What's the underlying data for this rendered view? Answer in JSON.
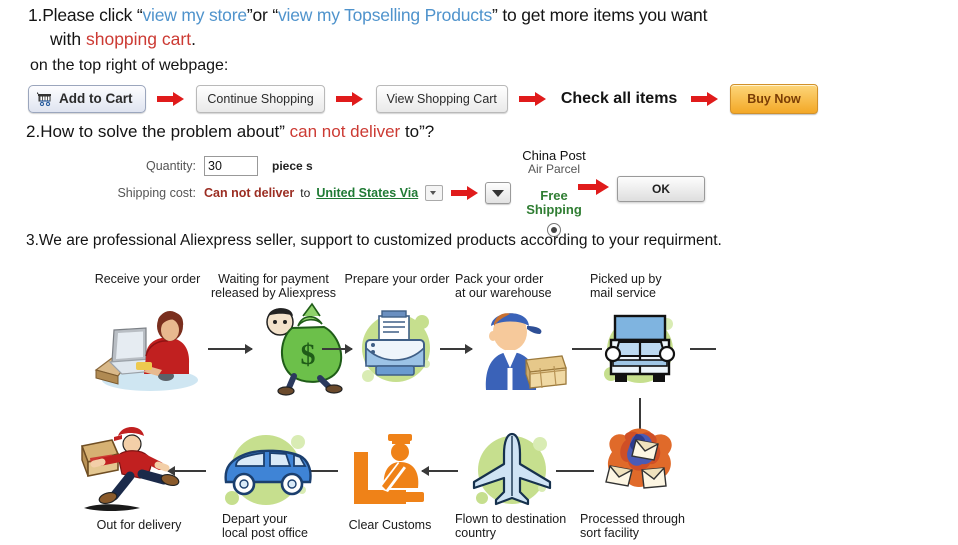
{
  "section1": {
    "number": "1.",
    "text_before_link1": "Please click “",
    "link1": "view my store",
    "text_between": "”or “",
    "link2": "view my Topselling Products",
    "text_after_link2": "” to get  more items you want",
    "line2_prefix": "with ",
    "line2_highlight": "shopping cart",
    "line2_suffix": ".",
    "line3": "on the top right of webpage:"
  },
  "buttons": {
    "add_to_cart": "Add to Cart",
    "continue_shopping": "Continue Shopping",
    "view_shopping_cart": "View Shopping Cart",
    "check_all_items": "Check all items",
    "buy_now": "Buy Now",
    "cart_icon": "shopping-cart-icon",
    "arrow_icon": "red-arrow-right-icon"
  },
  "section2": {
    "number": "2.",
    "heading_part1": "How to solve the problem about” ",
    "heading_highlight": "can not deliver",
    "heading_part2": " to”?",
    "quantity_label": "Quantity:",
    "quantity_value": "30",
    "quantity_unit": "piece s",
    "shipping_label": "Shipping cost:",
    "shipping_value": "Can not deliver",
    "shipping_to": "to",
    "shipping_country": "United States Via",
    "carrier_line1": "China Post",
    "carrier_line2": "Air Parcel",
    "free_line1": "Free",
    "free_line2": "Shipping",
    "ok_button": "OK"
  },
  "section3": {
    "number": "3",
    "text": ".We are professional Aliexpress seller, support to customized products according to your requirment."
  },
  "flow": {
    "steps_top": [
      {
        "caption": "Receive your order",
        "icon": "person-at-computer-icon"
      },
      {
        "caption": "Waiting for payment\nreleased by Aliexpress",
        "icon": "money-bag-icon"
      },
      {
        "caption": "Prepare your order",
        "icon": "printer-icon"
      },
      {
        "caption": "Pack your order\nat our warehouse",
        "icon": "worker-with-boxes-icon"
      },
      {
        "caption": "Picked up by\nmail service",
        "icon": "truck-icon"
      }
    ],
    "steps_bottom": [
      {
        "caption": "Out for delivery",
        "icon": "running-courier-icon"
      },
      {
        "caption": "Depart your\nlocal post office",
        "icon": "delivery-van-icon"
      },
      {
        "caption": "Clear Customs",
        "icon": "customs-officer-icon"
      },
      {
        "caption": "Flown to destination\ncountry",
        "icon": "airplane-icon"
      },
      {
        "caption": "Processed through\nsort facility",
        "icon": "envelopes-cluster-icon"
      }
    ]
  },
  "colors": {
    "link_blue": "#4f93cc",
    "highlight_red": "#cc3a33",
    "country_green": "#1f7a34",
    "free_shipping_green": "#2f7d32",
    "arrow_red": "#e01b1b",
    "buy_now_orange": "#f3a827",
    "blob_green": "#c6df8e"
  }
}
